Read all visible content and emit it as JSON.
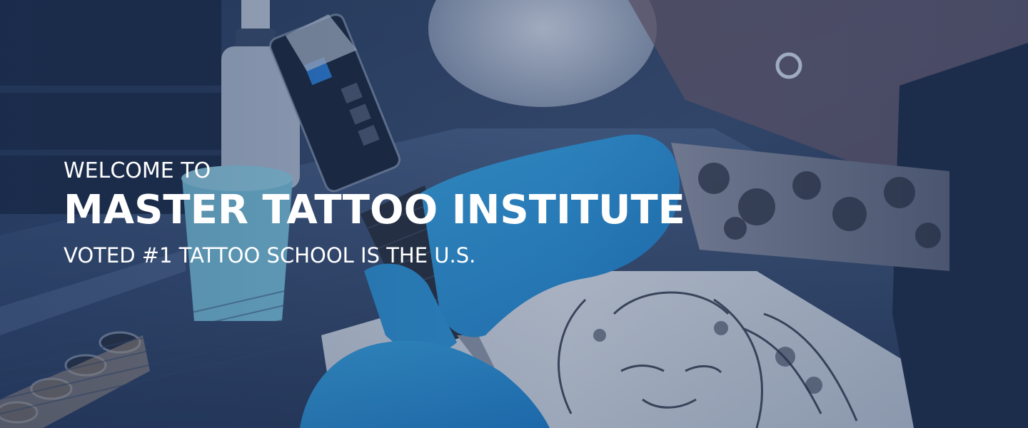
{
  "hero": {
    "eyebrow": "WELCOME TO",
    "headline": "MASTER TATTOO INSTITUTE",
    "tagline": "VOTED #1 TATTOO SCHOOL IS THE U.S.",
    "background_image": "tattoo-artist-working-photo",
    "overlay_color": "#16305c",
    "text_color": "#ffffff"
  }
}
